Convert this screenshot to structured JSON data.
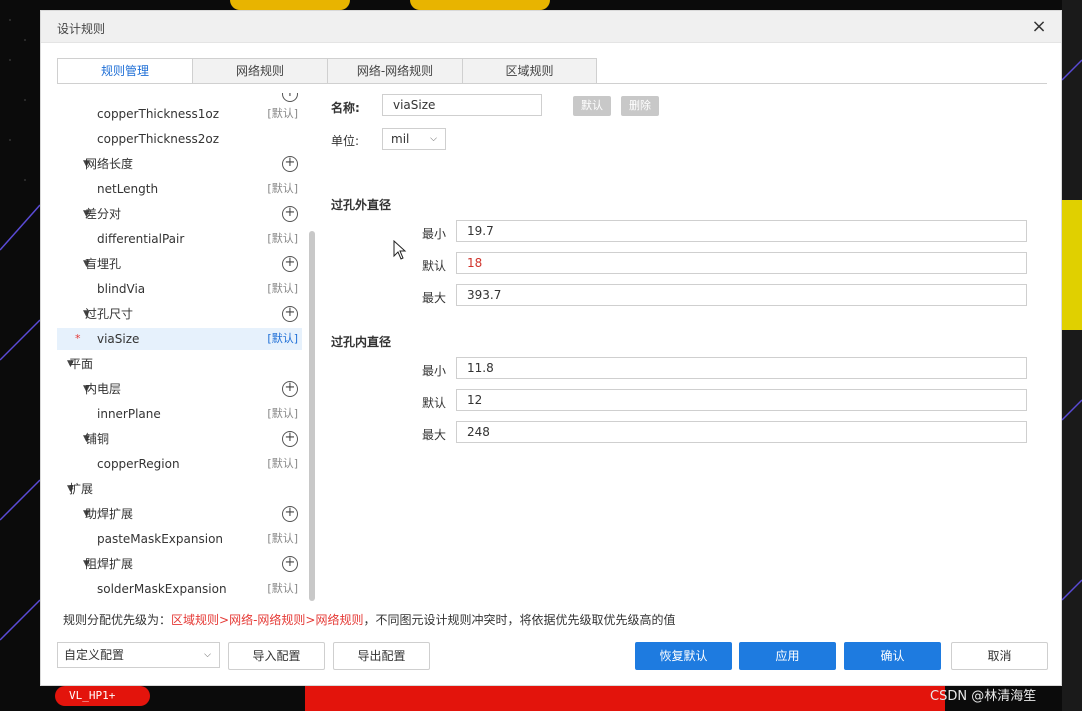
{
  "dialog": {
    "title": "设计规则",
    "close_glyph": "×"
  },
  "tabs": [
    {
      "label": "规则管理",
      "active": true
    },
    {
      "label": "网络规则",
      "active": false
    },
    {
      "label": "网络-网络规则",
      "active": false
    },
    {
      "label": "区域规则",
      "active": false
    }
  ],
  "tree": {
    "rows": [
      {
        "label": "copperThickness1oz",
        "indent": 2,
        "badge": "[默认]"
      },
      {
        "label": "copperThickness2oz",
        "indent": 2,
        "badge": ""
      },
      {
        "label": "网络长度",
        "indent": 1,
        "plus": true
      },
      {
        "label": "netLength",
        "indent": 2,
        "badge": "[默认]"
      },
      {
        "label": "差分对",
        "indent": 1,
        "plus": true
      },
      {
        "label": "differentialPair",
        "indent": 2,
        "badge": "[默认]"
      },
      {
        "label": "盲埋孔",
        "indent": 1,
        "plus": true
      },
      {
        "label": "blindVia",
        "indent": 2,
        "badge": "[默认]"
      },
      {
        "label": "过孔尺寸",
        "indent": 1,
        "plus": true
      },
      {
        "label": "viaSize",
        "indent": 2,
        "badge": "[默认]",
        "selected": true
      },
      {
        "label": "平面",
        "indent": 0
      },
      {
        "label": "内电层",
        "indent": 1,
        "plus": true
      },
      {
        "label": "innerPlane",
        "indent": 2,
        "badge": "[默认]"
      },
      {
        "label": "铺铜",
        "indent": 1,
        "plus": true
      },
      {
        "label": "copperRegion",
        "indent": 2,
        "badge": "[默认]"
      },
      {
        "label": "扩展",
        "indent": 0
      },
      {
        "label": "助焊扩展",
        "indent": 1,
        "plus": true
      },
      {
        "label": "pasteMaskExpansion",
        "indent": 2,
        "badge": "[默认]"
      },
      {
        "label": "阻焊扩展",
        "indent": 1,
        "plus": true
      },
      {
        "label": "solderMaskExpansion",
        "indent": 2,
        "badge": "[默认]"
      }
    ],
    "modified_marker": "*"
  },
  "form": {
    "name_label": "名称:",
    "name_value": "viaSize",
    "default_btn": "默认",
    "delete_btn": "删除",
    "unit_label": "单位:",
    "unit_value": "mil",
    "outer": {
      "title": "过孔外直径",
      "min_label": "最小",
      "min_value": "19.7",
      "default_label": "默认",
      "default_value": "18",
      "max_label": "最大",
      "max_value": "393.7"
    },
    "inner": {
      "title": "过孔内直径",
      "min_label": "最小",
      "min_value": "11.8",
      "default_label": "默认",
      "default_value": "12",
      "max_label": "最大",
      "max_value": "248"
    }
  },
  "footer": {
    "note_prefix": "规则分配优先级为：",
    "note_highlight": "区域规则>网络-网络规则>网络规则",
    "note_suffix": "，不同图元设计规则冲突时，将依据优先级取优先级高的值",
    "config_select": "自定义配置",
    "import_btn": "导入配置",
    "export_btn": "导出配置",
    "restore_btn": "恢复默认",
    "apply_btn": "应用",
    "ok_btn": "确认",
    "cancel_btn": "取消"
  },
  "background": {
    "net_label": "VL_HP1+",
    "watermark": "CSDN @林清海笙"
  },
  "colors": {
    "accent": "#1e7be0",
    "highlight": "#e53935",
    "pcb_red": "#e3140c",
    "pcb_yellow": "#e8b400"
  }
}
